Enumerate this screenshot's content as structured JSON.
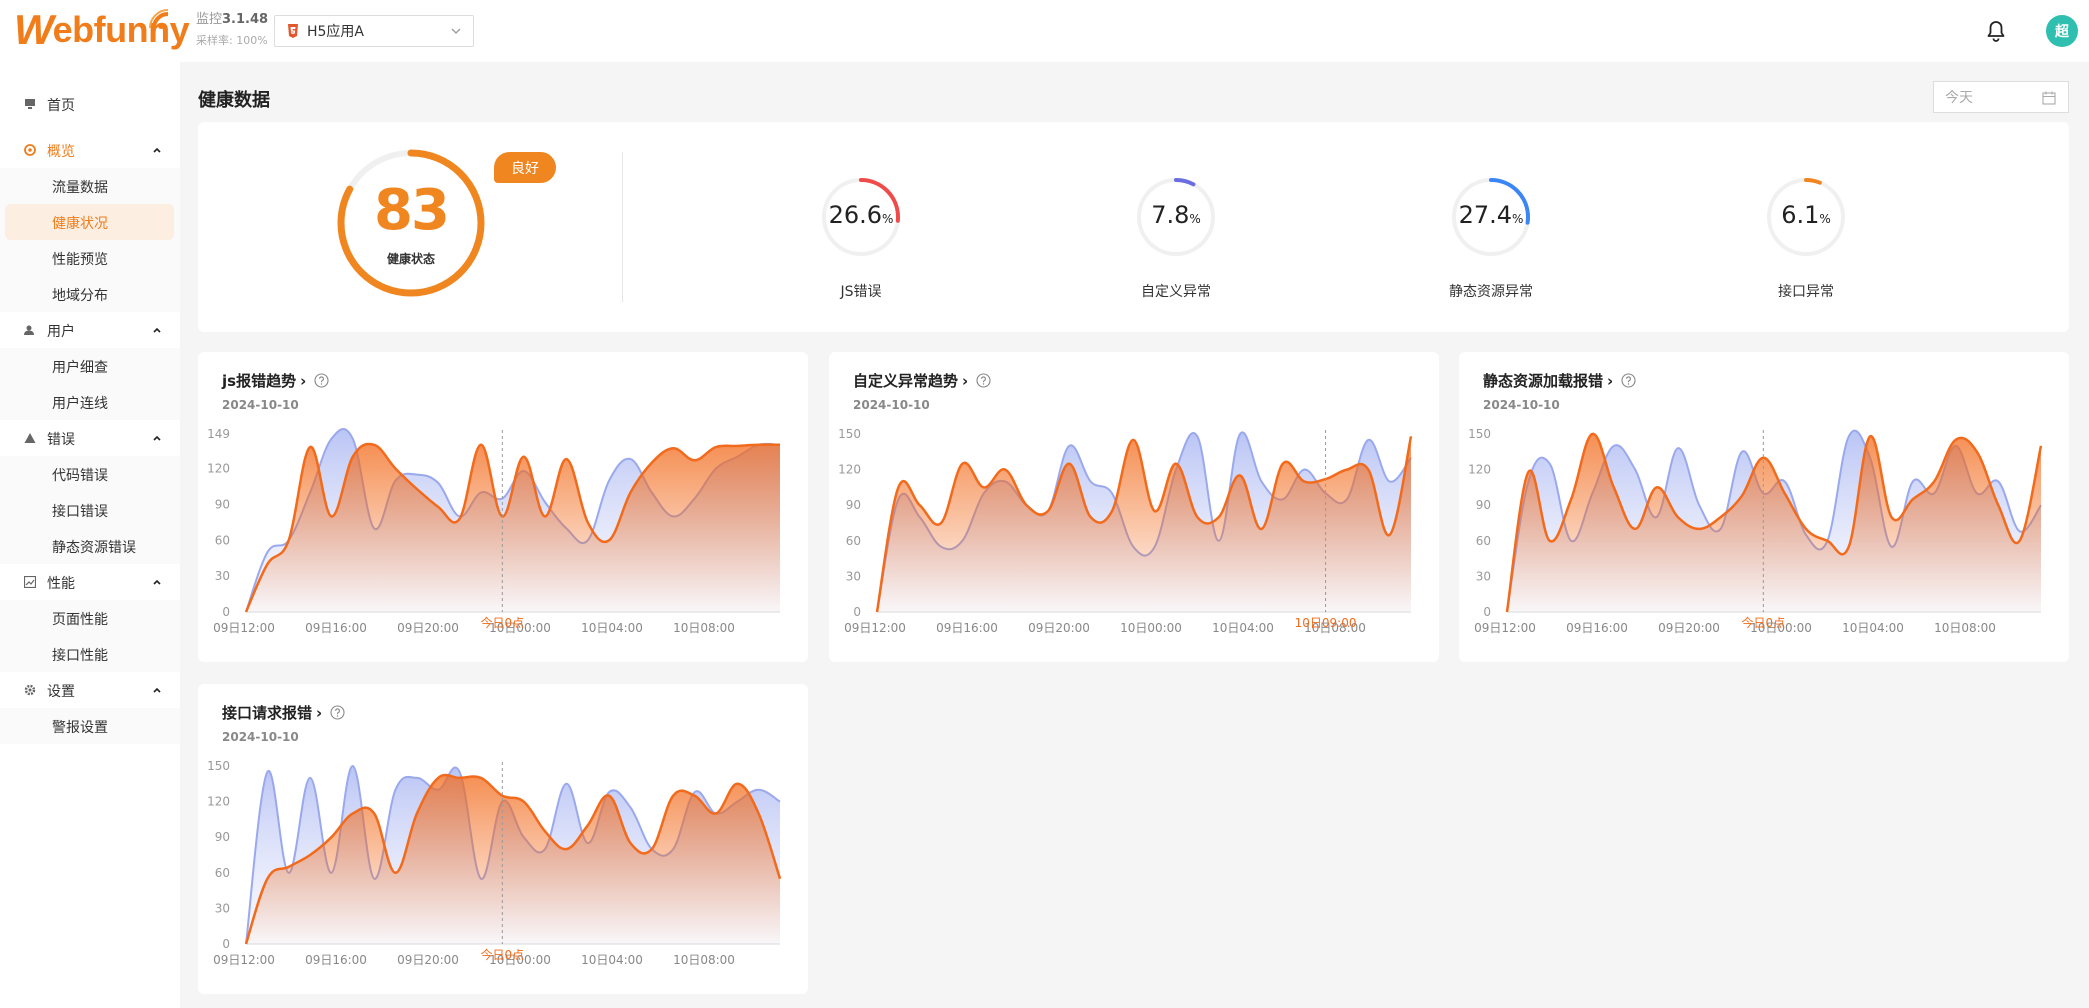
{
  "header": {
    "logo_first": "W",
    "logo_rest": "ebfunny",
    "version_label": "监控",
    "version": "3.1.48",
    "sample_label": "采样率:",
    "sample_value": "100%",
    "app_select": "H5应用A",
    "avatar_text": "超"
  },
  "sidebar": {
    "home": "首页",
    "overview": "概览",
    "overview_items": [
      "流量数据",
      "健康状况",
      "性能预览",
      "地域分布"
    ],
    "users": "用户",
    "users_items": [
      "用户细查",
      "用户连线"
    ],
    "errors": "错误",
    "errors_items": [
      "代码错误",
      "接口错误",
      "静态资源错误"
    ],
    "performance": "性能",
    "performance_items": [
      "页面性能",
      "接口性能"
    ],
    "settings": "设置",
    "settings_items": [
      "警报设置"
    ]
  },
  "main": {
    "title": "健康数据",
    "date_picker": "今天",
    "health_score": "83",
    "health_label": "健康状态",
    "health_badge": "良好",
    "metrics": [
      {
        "value": "26.6",
        "unit": "%",
        "label": "JS错误",
        "color": "#f04b4b",
        "fraction": 0.266
      },
      {
        "value": "7.8",
        "unit": "%",
        "label": "自定义异常",
        "color": "#6a6ee0",
        "fraction": 0.078
      },
      {
        "value": "27.4",
        "unit": "%",
        "label": "静态资源异常",
        "color": "#3a86f5",
        "fraction": 0.274
      },
      {
        "value": "6.1",
        "unit": "%",
        "label": "接口异常",
        "color": "#f0861f",
        "fraction": 0.061
      }
    ],
    "colors": {
      "accent": "#f07c1a",
      "today_line": "#f26a1b",
      "yesterday_area": "#b9c4f5"
    }
  },
  "chart_data": [
    {
      "type": "area",
      "title": "js报错趋势",
      "date": "2024-10-10",
      "y_ticks": [
        "0",
        "30",
        "60",
        "90",
        "120",
        "149"
      ],
      "ylim": [
        0,
        149
      ],
      "x_ticks": [
        "09日12:00",
        "09日16:00",
        "09日20:00",
        "10日00:00",
        "10日04:00",
        "10日08:00"
      ],
      "marker_label": "今日0点",
      "marker_x": 12,
      "series": [
        {
          "values": [
            0,
            50,
            60,
            100,
            145,
            145,
            70,
            110,
            115,
            108,
            80,
            100,
            95,
            118,
            92,
            70,
            60,
            110,
            128,
            100,
            80,
            95,
            120,
            130,
            140,
            140
          ]
        },
        {
          "values": [
            0,
            40,
            60,
            138,
            80,
            130,
            140,
            120,
            103,
            88,
            78,
            140,
            80,
            130,
            80,
            128,
            75,
            60,
            100,
            125,
            137,
            127,
            138,
            139,
            140,
            140
          ]
        }
      ]
    },
    {
      "type": "area",
      "title": "自定义异常趋势",
      "date": "2024-10-10",
      "y_ticks": [
        "0",
        "30",
        "60",
        "90",
        "120",
        "150"
      ],
      "ylim": [
        0,
        150
      ],
      "x_ticks": [
        "09日12:00",
        "09日16:00",
        "09日20:00",
        "10日00:00",
        "10日04:00",
        "10日08:00"
      ],
      "marker_label": "10日09:00",
      "marker_x": 21,
      "series": [
        {
          "values": [
            0,
            95,
            80,
            55,
            60,
            100,
            110,
            90,
            85,
            140,
            110,
            100,
            55,
            55,
            120,
            148,
            60,
            150,
            110,
            95,
            120,
            100,
            95,
            145,
            110,
            130
          ]
        },
        {
          "values": [
            0,
            105,
            90,
            75,
            125,
            105,
            120,
            90,
            85,
            125,
            80,
            85,
            145,
            85,
            125,
            80,
            80,
            115,
            70,
            125,
            110,
            112,
            120,
            120,
            65,
            148
          ]
        }
      ]
    },
    {
      "type": "area",
      "title": "静态资源加载报错",
      "date": "2024-10-10",
      "y_ticks": [
        "0",
        "30",
        "60",
        "90",
        "120",
        "150"
      ],
      "ylim": [
        0,
        150
      ],
      "x_ticks": [
        "09日12:00",
        "09日16:00",
        "09日20:00",
        "10日00:00",
        "10日04:00",
        "10日08:00"
      ],
      "marker_label": "今日0点",
      "marker_x": 12,
      "series": [
        {
          "values": [
            0,
            110,
            125,
            60,
            100,
            140,
            120,
            80,
            138,
            90,
            70,
            135,
            100,
            110,
            65,
            60,
            148,
            130,
            55,
            110,
            100,
            140,
            100,
            110,
            68,
            90
          ]
        },
        {
          "values": [
            0,
            118,
            60,
            95,
            150,
            105,
            70,
            105,
            80,
            70,
            80,
            98,
            130,
            100,
            70,
            60,
            55,
            148,
            80,
            95,
            110,
            145,
            135,
            90,
            60,
            140
          ]
        }
      ]
    },
    {
      "type": "area",
      "title": "接口请求报错",
      "date": "2024-10-10",
      "y_ticks": [
        "0",
        "30",
        "60",
        "90",
        "120",
        "150"
      ],
      "ylim": [
        0,
        150
      ],
      "x_ticks": [
        "09日12:00",
        "09日16:00",
        "09日20:00",
        "10日00:00",
        "10日04:00",
        "10日08:00"
      ],
      "marker_label": "今日0点",
      "marker_x": 12,
      "series": [
        {
          "values": [
            0,
            145,
            60,
            140,
            60,
            150,
            55,
            130,
            140,
            130,
            145,
            55,
            120,
            90,
            80,
            135,
            85,
            128,
            115,
            80,
            80,
            128,
            110,
            120,
            130,
            120
          ]
        },
        {
          "values": [
            0,
            55,
            65,
            75,
            90,
            110,
            110,
            60,
            110,
            140,
            140,
            140,
            125,
            120,
            95,
            80,
            100,
            125,
            85,
            80,
            125,
            125,
            110,
            135,
            110,
            55
          ]
        }
      ]
    }
  ]
}
